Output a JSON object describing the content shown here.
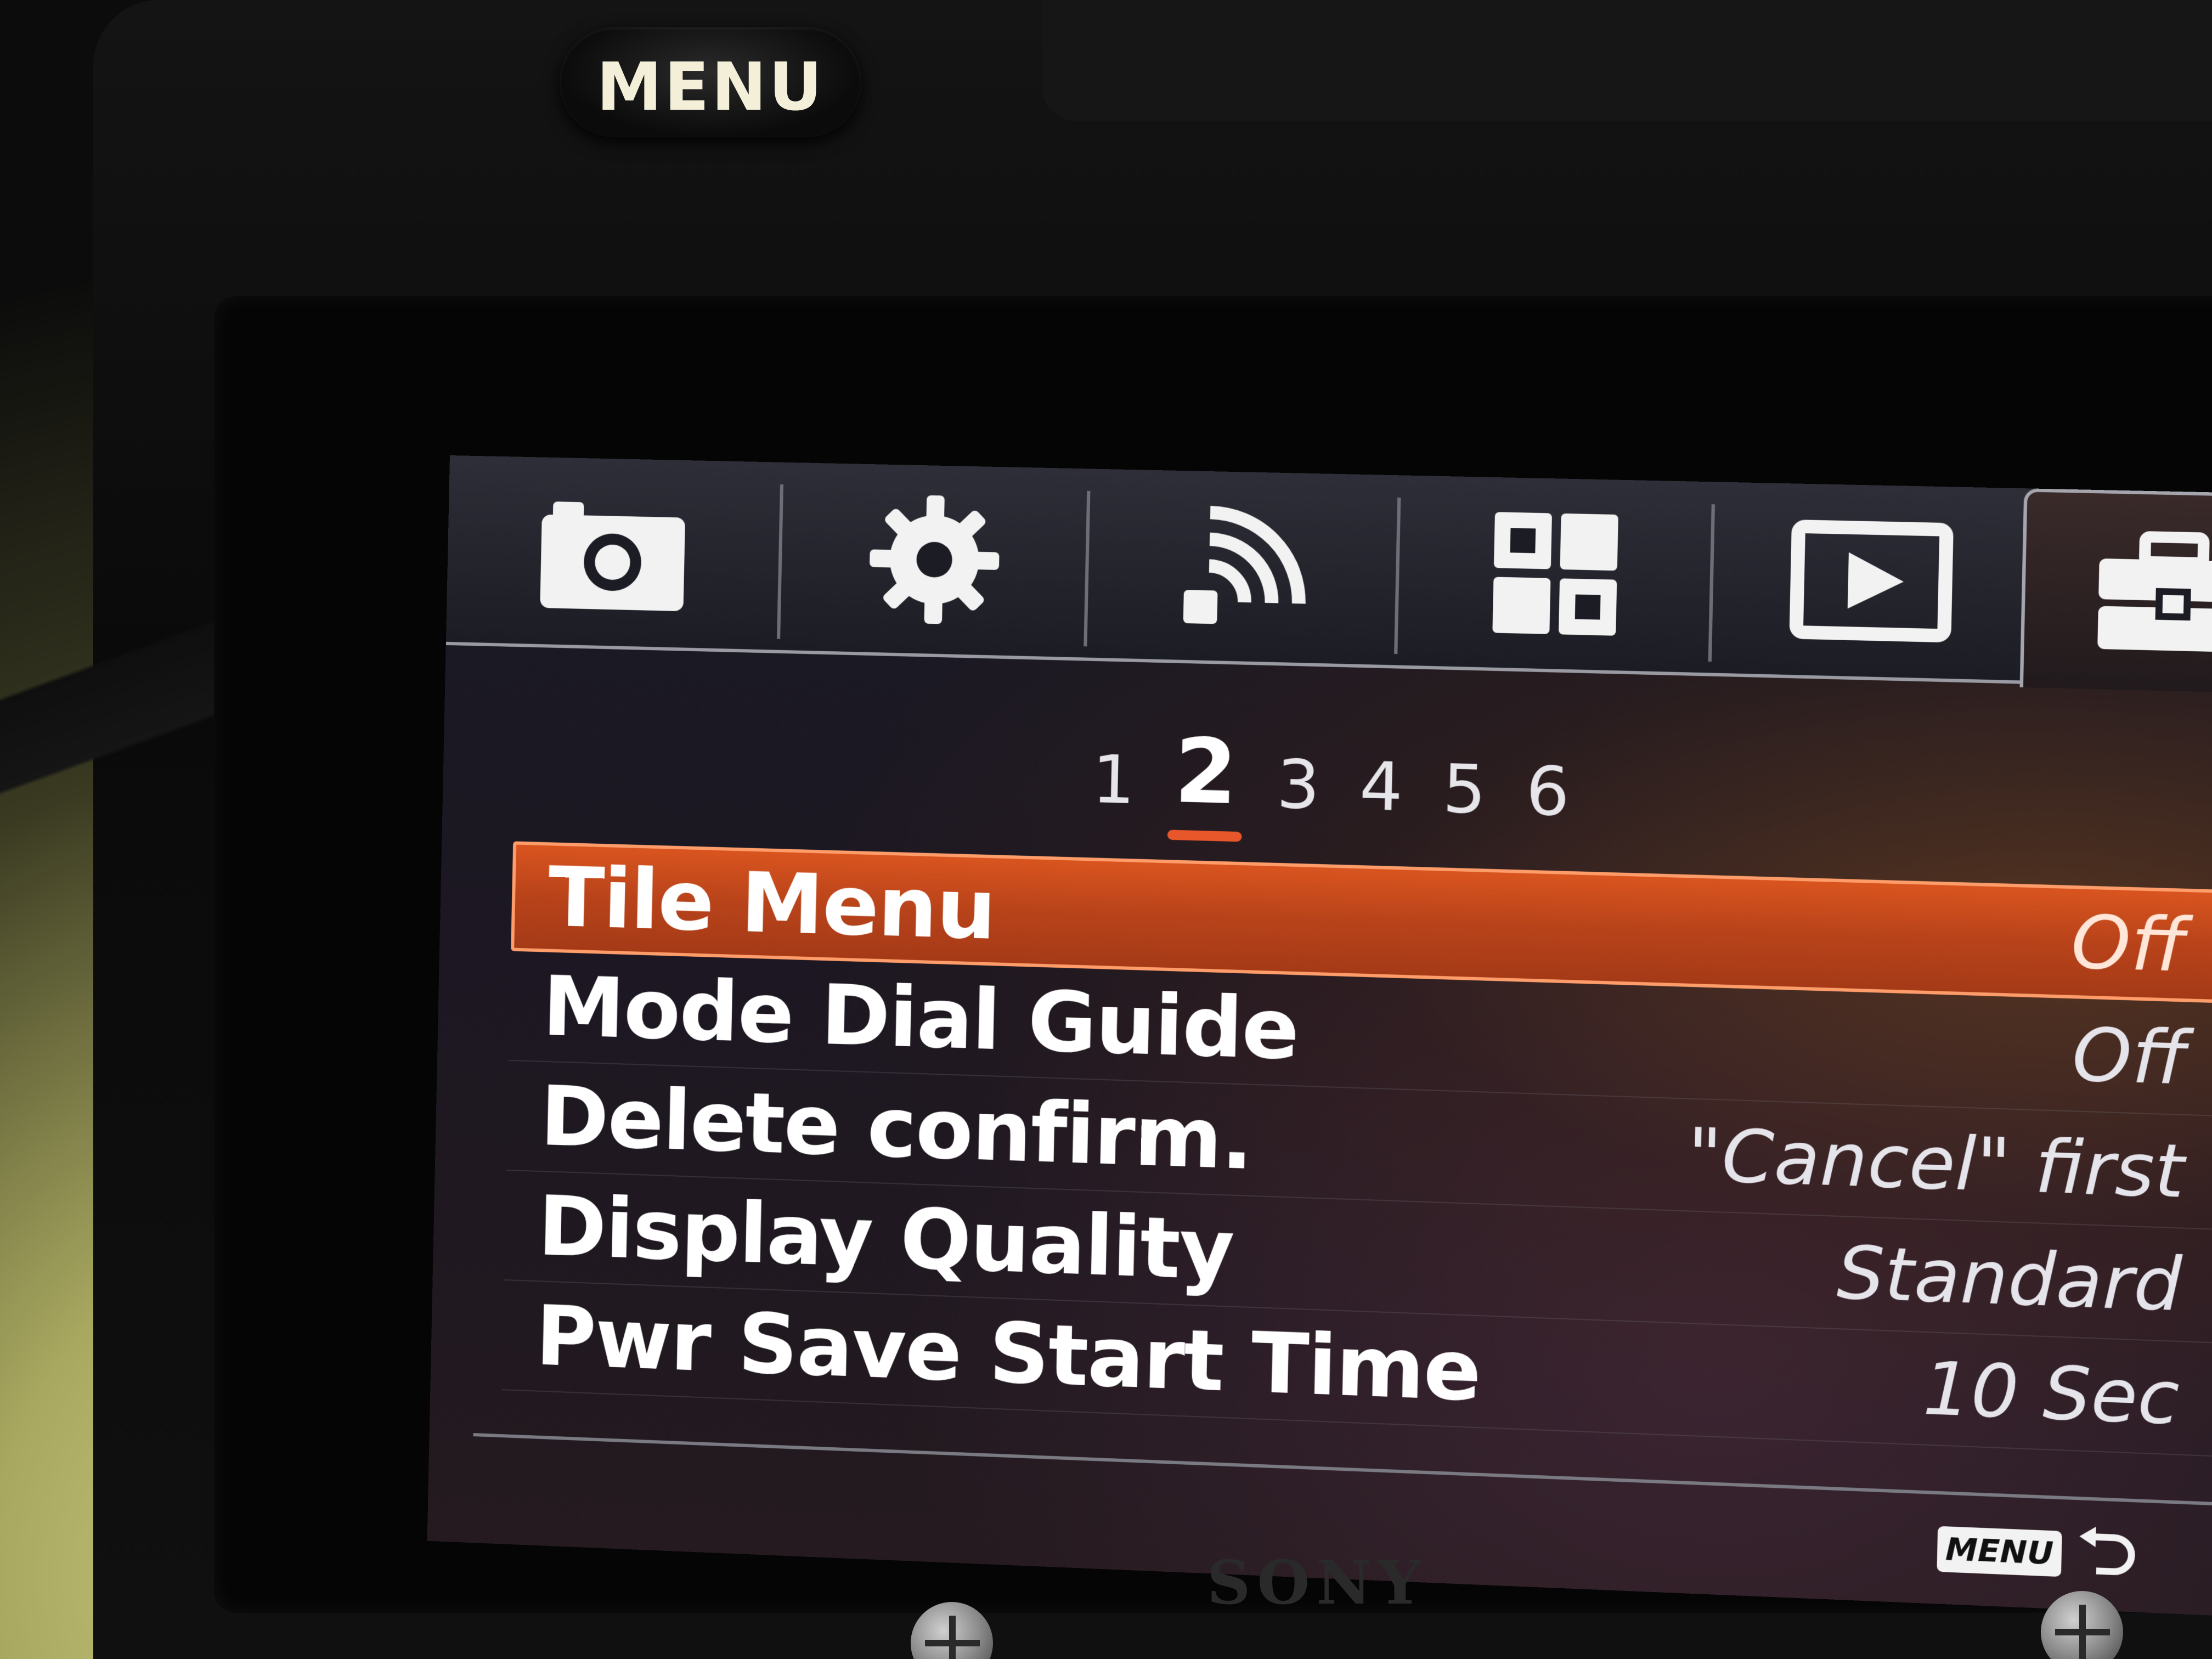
{
  "camera": {
    "menu_button_label": "MENU",
    "brand_logo": "SONY"
  },
  "tabs": [
    {
      "icon": "camera-icon",
      "active": false
    },
    {
      "icon": "gear-icon",
      "active": false
    },
    {
      "icon": "wireless-icon",
      "active": false
    },
    {
      "icon": "applications-icon",
      "active": false
    },
    {
      "icon": "playback-icon",
      "active": false
    },
    {
      "icon": "toolbox-icon",
      "active": true
    }
  ],
  "pages": [
    "1",
    "2",
    "3",
    "4",
    "5",
    "6"
  ],
  "current_page": "2",
  "menu_items": [
    {
      "label": "Tile Menu",
      "value": "Off",
      "selected": true
    },
    {
      "label": "Mode Dial Guide",
      "value": "Off",
      "selected": false
    },
    {
      "label": "Delete confirm.",
      "value": "\"Cancel\" first",
      "selected": false
    },
    {
      "label": "Display Quality",
      "value": "Standard",
      "selected": false
    },
    {
      "label": "Pwr Save Start Time",
      "value": "10 Sec",
      "selected": false
    }
  ],
  "footer": {
    "back_badge": "MENU"
  },
  "colors": {
    "highlight": "#d9541f",
    "page_underline": "#e8572a",
    "text": "#ffffff"
  }
}
